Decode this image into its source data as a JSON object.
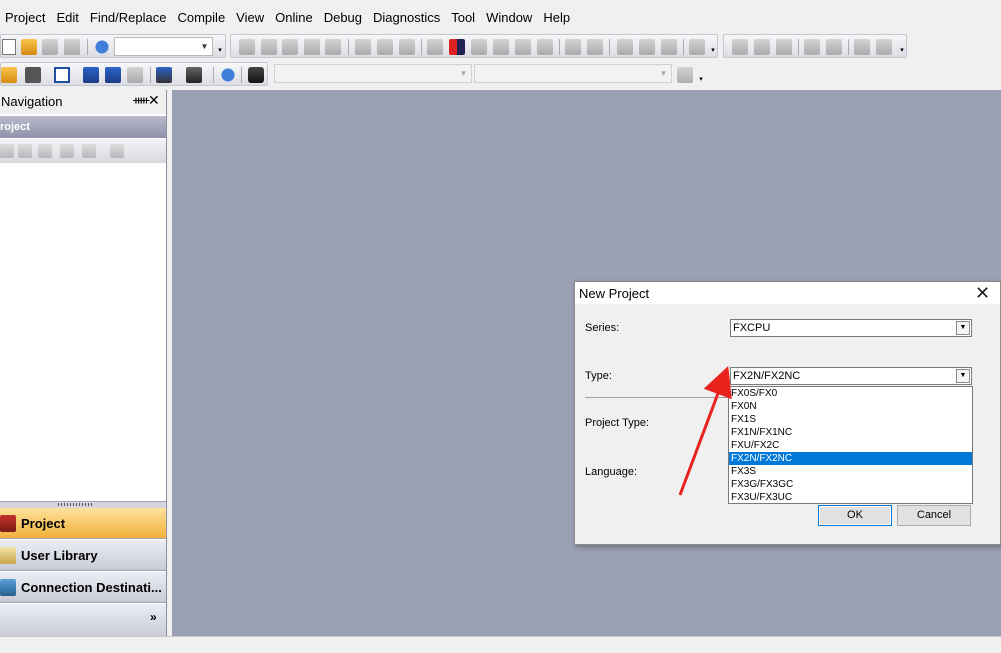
{
  "menu": [
    "Project",
    "Edit",
    "Find/Replace",
    "Compile",
    "View",
    "Online",
    "Debug",
    "Diagnostics",
    "Tool",
    "Window",
    "Help"
  ],
  "navigation": {
    "title": "Navigation",
    "section": "roject",
    "tabs": [
      {
        "label": "Project",
        "active": true
      },
      {
        "label": "User Library",
        "active": false
      },
      {
        "label": "Connection Destinati...",
        "active": false
      }
    ]
  },
  "dialog": {
    "title": "New Project",
    "series_label": "Series:",
    "series_value": "FXCPU",
    "type_label": "Type:",
    "type_value": "FX2N/FX2NC",
    "project_type_label": "Project Type:",
    "language_label": "Language:",
    "type_options": [
      "FX0S/FX0",
      "FX0N",
      "FX1S",
      "FX1N/FX1NC",
      "FXU/FX2C",
      "FX2N/FX2NC",
      "FX3S",
      "FX3G/FX3GC",
      "FX3U/FX3UC"
    ],
    "selected_index": 5,
    "ok_label": "OK",
    "cancel_label": "Cancel"
  },
  "colors": {
    "workspace": "#9aa0b4",
    "selection": "#0078d7",
    "annotation_arrow": "#e8231d",
    "active_tab": "#f3b13b"
  },
  "icons": [
    "new-file-icon",
    "open-folder-icon",
    "save-icon",
    "print-icon",
    "help-icon",
    "cut-icon",
    "copy-icon",
    "paste-icon",
    "undo-icon",
    "redo-icon",
    "binoculars-icon",
    "pin-icon",
    "close-icon"
  ]
}
